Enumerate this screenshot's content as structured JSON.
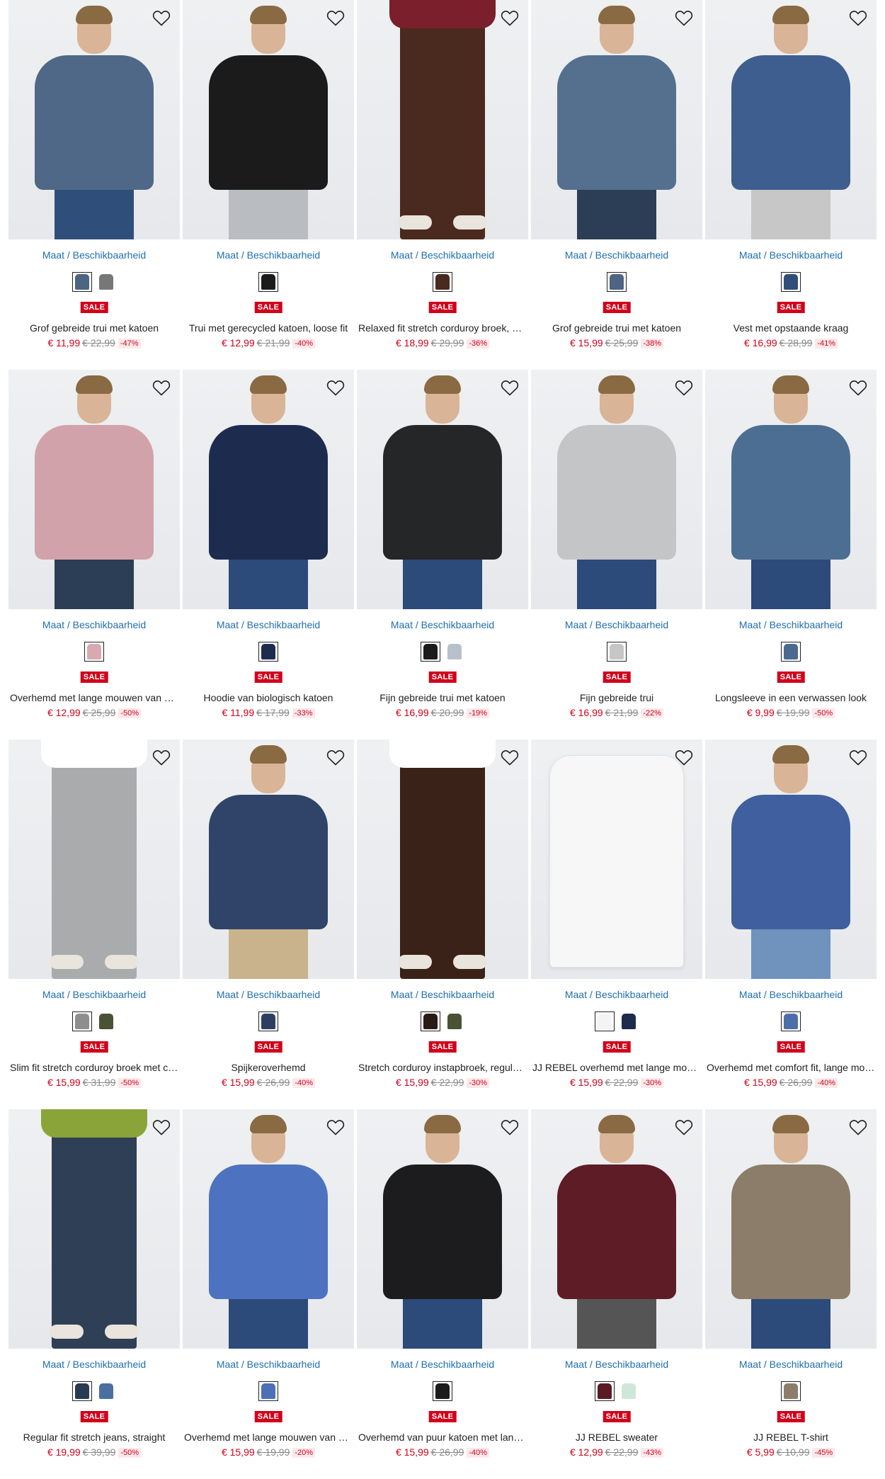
{
  "labels": {
    "size_link": "Maat / Beschikbaarheid",
    "sale_badge": "SALE"
  },
  "products": [
    {
      "title": "Grof gebreide trui met katoen",
      "price": "€ 11,99",
      "old_price": "€ 22,99",
      "discount": "-47%",
      "colors": [
        "#4d6482",
        "#777777"
      ],
      "kind": "person",
      "top": "#4f6888",
      "legs": "#2f4f7a"
    },
    {
      "title": "Trui met gerecycled katoen, loose fit",
      "price": "€ 12,99",
      "old_price": "€ 21,99",
      "discount": "-40%",
      "colors": [
        "#1b1b1b"
      ],
      "kind": "person",
      "top": "#1b1b1b",
      "legs": "#b9bcc0"
    },
    {
      "title": "Relaxed fit stretch corduroy broek, straight",
      "price": "€ 18,99",
      "old_price": "€ 29,99",
      "discount": "-36%",
      "colors": [
        "#4a2a1e"
      ],
      "kind": "legs",
      "top": "#7a1f2b",
      "legs": "#4a2a1e"
    },
    {
      "title": "Grof gebreide trui met katoen",
      "price": "€ 15,99",
      "old_price": "€ 25,99",
      "discount": "-38%",
      "colors": [
        "#4d6482"
      ],
      "kind": "person",
      "top": "#556f8f",
      "legs": "#2c3e55"
    },
    {
      "title": "Vest met opstaande kraag",
      "price": "€ 16,99",
      "old_price": "€ 28,99",
      "discount": "-41%",
      "colors": [
        "#2f4f7a"
      ],
      "kind": "person",
      "top": "#3d5e8f",
      "legs": "#c7c7c7"
    },
    {
      "title": "Overhemd met lange mouwen van katoen",
      "price": "€ 12,99",
      "old_price": "€ 25,99",
      "discount": "-50%",
      "colors": [
        "#d9a9b1"
      ],
      "kind": "person",
      "top": "#d2a2aa",
      "legs": "#2c3e55"
    },
    {
      "title": "Hoodie van biologisch katoen",
      "price": "€ 11,99",
      "old_price": "€ 17,99",
      "discount": "-33%",
      "colors": [
        "#1d2b4f"
      ],
      "kind": "person",
      "top": "#1d2b4f",
      "legs": "#2c4a7a"
    },
    {
      "title": "Fijn gebreide trui met katoen",
      "price": "€ 16,99",
      "old_price": "€ 20,99",
      "discount": "-19%",
      "colors": [
        "#1b1b1b",
        "#b8c0cc"
      ],
      "kind": "person",
      "top": "#252628",
      "legs": "#2c4a7a"
    },
    {
      "title": "Fijn gebreide trui",
      "price": "€ 16,99",
      "old_price": "€ 21,99",
      "discount": "-22%",
      "colors": [
        "#c6c6c6"
      ],
      "kind": "person",
      "top": "#c4c5c7",
      "legs": "#2c4a7a"
    },
    {
      "title": "Longsleeve in een verwassen look",
      "price": "€ 9,99",
      "old_price": "€ 19,99",
      "discount": "-50%",
      "colors": [
        "#4a6b8f"
      ],
      "kind": "person",
      "top": "#4d6e93",
      "legs": "#2c4a7a"
    },
    {
      "title": "Slim fit stretch corduroy broek met comfort",
      "price": "€ 15,99",
      "old_price": "€ 31,99",
      "discount": "-50%",
      "colors": [
        "#8e8e8e",
        "#4a5236"
      ],
      "kind": "legs",
      "top": "#ffffff",
      "legs": "#a9abad"
    },
    {
      "title": "Spijkeroverhemd",
      "price": "€ 15,99",
      "old_price": "€ 26,99",
      "discount": "-40%",
      "colors": [
        "#2c3f63"
      ],
      "kind": "person",
      "top": "#2f4468",
      "legs": "#c9b38c"
    },
    {
      "title": "Stretch corduroy instapbroek, regular fit",
      "price": "€ 15,99",
      "old_price": "€ 22,99",
      "discount": "-30%",
      "colors": [
        "#2a1a14",
        "#4a5236"
      ],
      "kind": "legs",
      "top": "#ffffff",
      "legs": "#3a2218"
    },
    {
      "title": "JJ REBEL overhemd met lange mouwen",
      "price": "€ 15,99",
      "old_price": "€ 22,99",
      "discount": "-30%",
      "colors": [
        "#f4f4f4",
        "#1d2b4f"
      ],
      "kind": "shirt",
      "top": "#f7f7f7",
      "legs": "#f7f7f7"
    },
    {
      "title": "Overhemd met comfort fit, lange mouwen",
      "price": "€ 15,99",
      "old_price": "€ 26,99",
      "discount": "-40%",
      "colors": [
        "#4d6fa8"
      ],
      "kind": "person",
      "top": "#3f5f9e",
      "legs": "#6f93bd"
    },
    {
      "title": "Regular fit stretch jeans, straight",
      "price": "€ 19,99",
      "old_price": "€ 39,99",
      "discount": "-50%",
      "colors": [
        "#2a3a52",
        "#4a6fa0"
      ],
      "kind": "legs",
      "top": "#8aa43a",
      "legs": "#2f3f55"
    },
    {
      "title": "Overhemd met lange mouwen van katoen",
      "price": "€ 15,99",
      "old_price": "€ 19,99",
      "discount": "-20%",
      "colors": [
        "#4d6fb8"
      ],
      "kind": "person",
      "top": "#4d72bf",
      "legs": "#2c4a7a"
    },
    {
      "title": "Overhemd van puur katoen met lange mouwen",
      "price": "€ 15,99",
      "old_price": "€ 26,99",
      "discount": "-40%",
      "colors": [
        "#1b1b1b"
      ],
      "kind": "person",
      "top": "#1c1c1e",
      "legs": "#2c4a7a"
    },
    {
      "title": "JJ REBEL sweater",
      "price": "€ 12,99",
      "old_price": "€ 22,99",
      "discount": "-43%",
      "colors": [
        "#5a1a24",
        "#cfe7d9"
      ],
      "kind": "person",
      "top": "#5e1c26",
      "legs": "#555555"
    },
    {
      "title": "JJ REBEL T-shirt",
      "price": "€ 5,99",
      "old_price": "€ 10,99",
      "discount": "-45%",
      "colors": [
        "#8c7e6a"
      ],
      "kind": "person",
      "top": "#8b7d69",
      "legs": "#2c4a7a"
    }
  ]
}
